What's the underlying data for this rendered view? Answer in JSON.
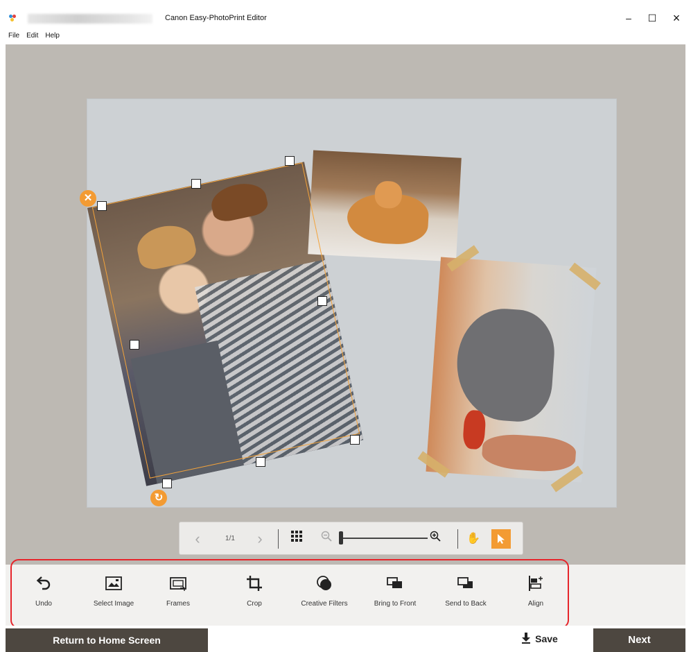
{
  "window": {
    "title": "Canon Easy-PhotoPrint Editor",
    "controls": {
      "minimize": "–",
      "maximize": "☐",
      "close": "×"
    }
  },
  "menu": [
    "File",
    "Edit",
    "Help"
  ],
  "page_toolbar": {
    "page_indicator": "1/1",
    "prev_icon": "chevron-left",
    "next_icon": "chevron-right",
    "grid_icon": "grid",
    "zoom_out_icon": "zoom-out",
    "zoom_in_icon": "zoom-in",
    "pan_icon": "hand",
    "select_icon": "pointer",
    "zoom_level": 0
  },
  "tools": [
    {
      "label": "Undo",
      "icon": "undo"
    },
    {
      "label": "Select Image",
      "icon": "select-image"
    },
    {
      "label": "Frames",
      "icon": "frames"
    },
    {
      "label": "Crop",
      "icon": "crop"
    },
    {
      "label": "Creative Filters",
      "icon": "creative-filters"
    },
    {
      "label": "Bring to Front",
      "icon": "bring-to-front"
    },
    {
      "label": "Send to Back",
      "icon": "send-to-back"
    },
    {
      "label": "Align",
      "icon": "align"
    }
  ],
  "footer": {
    "home_label": "Return to Home Screen",
    "save_label": "Save",
    "next_label": "Next"
  },
  "colors": {
    "accent": "#f39b33",
    "highlight_box": "#e6242a",
    "footer_button": "#4d4740",
    "workspace": "#bdb9b3",
    "canvas": "#cdd1d4"
  }
}
